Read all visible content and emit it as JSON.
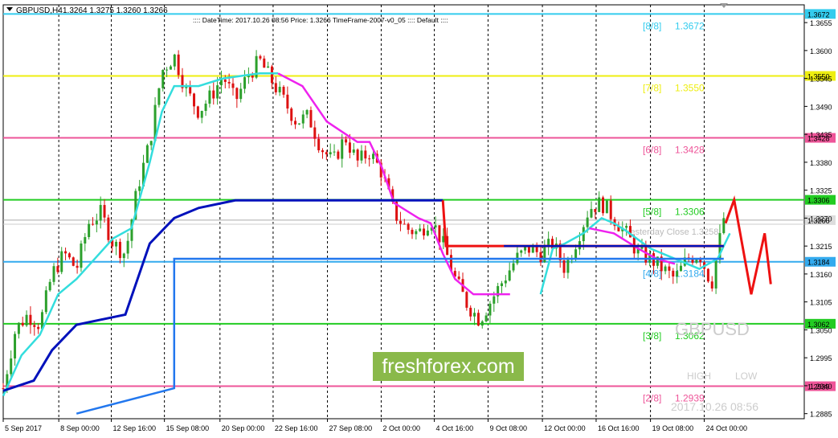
{
  "window": {
    "symbol_tf": "GBPUSD,H4",
    "ohlc": "1.3264 1.3275 1.3260 1.3266",
    "menu_icon": "triangle-down-icon",
    "info_line": ":::: DateTime: 2017.10.26 08:56    Price: 1.3266    TimeFrame-2007-v0_05   :::: Default  ::::"
  },
  "watermark": {
    "symbol": "GBPUSD",
    "high": "HIGH",
    "low": "LOW",
    "datetime": "2017.10.26 08:56"
  },
  "brand": {
    "text": "freshforex.com"
  },
  "colors": {
    "bull": "#2ca02c",
    "bear": "#dd1111",
    "cyan": "#33dddd",
    "magenta": "#ee22ee",
    "navy": "#0011bb",
    "blue": "#2277ee",
    "red": "#ee1111"
  },
  "chart_data": {
    "type": "candlestick",
    "ylim": [
      1.2875,
      1.369
    ],
    "y_ticks": [
      "1.3655",
      "1.3600",
      "1.3545",
      "1.3490",
      "1.3435",
      "1.3380",
      "1.3325",
      "1.3270",
      "1.3215",
      "1.3160",
      "1.3105",
      "1.3050",
      "1.2995",
      "1.2940",
      "1.2885"
    ],
    "x_labels": [
      "5 Sep 2017",
      "8 Sep 00:00",
      "12 Sep 16:00",
      "15 Sep 08:00",
      "20 Sep 00:00",
      "22 Sep 16:00",
      "27 Sep 08:00",
      "2 Oct 00:00",
      "4 Oct 16:00",
      "9 Oct 08:00",
      "12 Oct 00:00",
      "16 Oct 16:00",
      "19 Oct 08:00",
      "24 Oct 00:00"
    ],
    "x_label_pos": [
      0,
      0.091,
      0.177,
      0.264,
      0.355,
      0.442,
      0.531,
      0.619,
      0.706,
      0.794,
      0.883,
      0.971,
      1.06,
      1.148
    ],
    "murrey_levels": [
      {
        "label": "[8/8]",
        "value": "1.3672",
        "color": "#33ccee"
      },
      {
        "label": "[7/8]",
        "value": "1.3550",
        "color": "#eeee11"
      },
      {
        "label": "[6/8]",
        "value": "1.3428",
        "color": "#ee5599"
      },
      {
        "label": "[5/8]",
        "value": "1.3306",
        "color": "#22cc22"
      },
      {
        "label": "[4/8]",
        "value": "1.3184",
        "color": "#33aaee"
      },
      {
        "label": "[3/8]",
        "value": "1.3062",
        "color": "#22cc22"
      },
      {
        "label": "[2/8]",
        "value": "1.2939",
        "color": "#ee5599"
      }
    ],
    "current_price": "1.3266",
    "yesterday_close_label": "Yesterday Close 1.3258",
    "yesterday_close": "1.3258",
    "close_path": [
      [
        0,
        1.2935
      ],
      [
        0.02,
        1.305
      ],
      [
        0.04,
        1.308
      ],
      [
        0.06,
        1.306
      ],
      [
        0.08,
        1.316
      ],
      [
        0.1,
        1.32
      ],
      [
        0.12,
        1.317
      ],
      [
        0.14,
        1.326
      ],
      [
        0.16,
        1.328
      ],
      [
        0.18,
        1.322
      ],
      [
        0.2,
        1.32
      ],
      [
        0.22,
        1.333
      ],
      [
        0.24,
        1.342
      ],
      [
        0.26,
        1.356
      ],
      [
        0.28,
        1.359
      ],
      [
        0.3,
        1.352
      ],
      [
        0.32,
        1.348
      ],
      [
        0.34,
        1.351
      ],
      [
        0.36,
        1.355
      ],
      [
        0.38,
        1.35
      ],
      [
        0.4,
        1.355
      ],
      [
        0.42,
        1.358
      ],
      [
        0.44,
        1.354
      ],
      [
        0.46,
        1.35
      ],
      [
        0.48,
        1.346
      ],
      [
        0.5,
        1.347
      ],
      [
        0.52,
        1.341
      ],
      [
        0.54,
        1.338
      ],
      [
        0.56,
        1.343
      ],
      [
        0.58,
        1.338
      ],
      [
        0.6,
        1.34
      ],
      [
        0.62,
        1.336
      ],
      [
        0.64,
        1.328
      ],
      [
        0.66,
        1.325
      ],
      [
        0.68,
        1.324
      ],
      [
        0.7,
        1.327
      ],
      [
        0.72,
        1.322
      ],
      [
        0.74,
        1.315
      ],
      [
        0.76,
        1.31
      ],
      [
        0.78,
        1.307
      ],
      [
        0.8,
        1.311
      ],
      [
        0.82,
        1.315
      ],
      [
        0.84,
        1.319
      ],
      [
        0.86,
        1.321
      ],
      [
        0.88,
        1.32
      ],
      [
        0.9,
        1.322
      ],
      [
        0.92,
        1.317
      ],
      [
        0.94,
        1.323
      ],
      [
        0.96,
        1.329
      ],
      [
        0.98,
        1.33
      ],
      [
        1.0,
        1.327
      ],
      [
        1.02,
        1.324
      ],
      [
        1.04,
        1.32
      ],
      [
        1.06,
        1.319
      ],
      [
        1.08,
        1.317
      ],
      [
        1.1,
        1.315
      ],
      [
        1.12,
        1.319
      ],
      [
        1.14,
        1.32
      ],
      [
        1.16,
        1.314
      ],
      [
        1.18,
        1.327
      ]
    ]
  }
}
